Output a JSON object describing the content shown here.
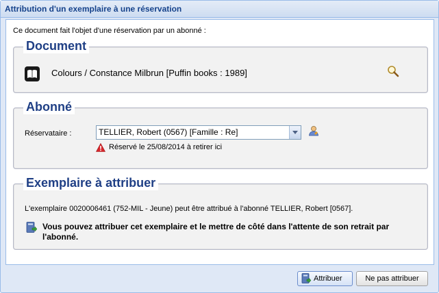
{
  "window": {
    "title": "Attribution d'un exemplaire à une réservation"
  },
  "intro": "Ce document fait l'objet d'une réservation par un abonné :",
  "document": {
    "legend": "Document",
    "text": "Colours / Constance Milbrun [Puffin books : 1989]",
    "icon": "book-icon",
    "action_icon": "magnifier-icon"
  },
  "abonne": {
    "legend": "Abonné",
    "label": "Réservataire :",
    "selected": "TELLIER, Robert (0567) [Famille : Re]",
    "warning": "Réservé le 25/08/2014 à retirer ici",
    "warning_icon": "warning-icon",
    "user_icon": "user-icon"
  },
  "exemplaire": {
    "legend": "Exemplaire à attribuer",
    "text": "L'exemplaire 0020006461 (752-MIL - Jeune) peut être attribué à l'abonné TELLIER, Robert [0567].",
    "info": "Vous pouvez attribuer cet exemplaire et le mettre de côté dans l'attente de son retrait par l'abonné.",
    "info_icon": "info-book-icon"
  },
  "buttons": {
    "attribuer": "Attribuer",
    "ne_pas_attribuer": "Ne pas attribuer"
  },
  "colors": {
    "legend": "#1f3f85",
    "title": "#15428b",
    "frame": "#dfe8f6",
    "border": "#99bbe8",
    "warning": "#c4161c"
  }
}
